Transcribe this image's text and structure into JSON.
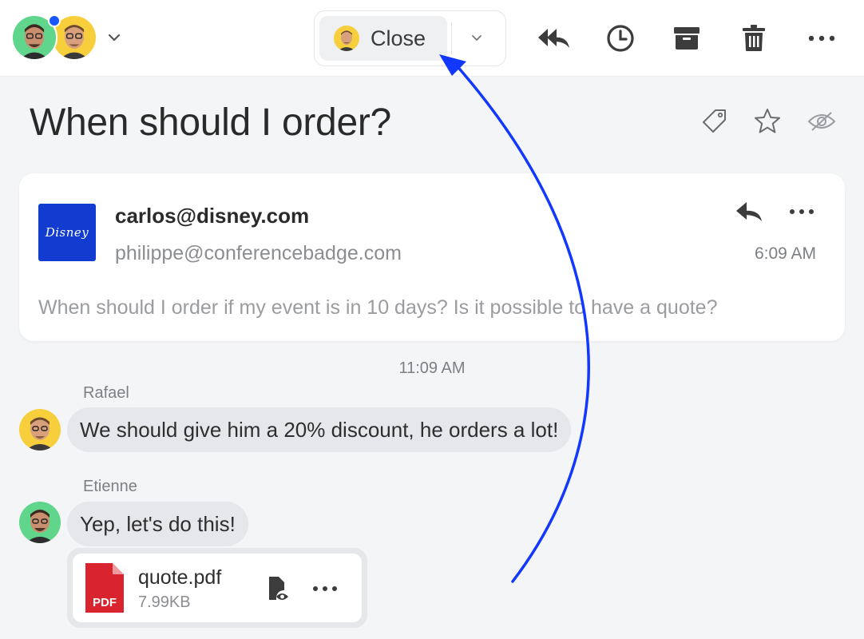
{
  "toolbar": {
    "close_label": "Close",
    "icons": [
      "reply-all-icon",
      "clock-icon",
      "archive-icon",
      "trash-icon",
      "more-icon"
    ]
  },
  "conversation": {
    "subject": "When should I order?",
    "subject_icons": [
      "tag-icon",
      "star-icon",
      "eye-slash-icon"
    ]
  },
  "email": {
    "brand": "Disney",
    "from": "carlos@disney.com",
    "to": "philippe@conferencebadge.com",
    "time": "6:09 AM",
    "preview": "When should I order if my event is in 10 days? Is it possible to have a quote?"
  },
  "chat": {
    "divider_time": "11:09 AM",
    "messages": [
      {
        "sender": "Rafael",
        "text": "We should give him a 20% discount, he orders a lot!"
      },
      {
        "sender": "Etienne",
        "text": "Yep, let's do this!"
      }
    ],
    "attachment": {
      "type_label": "PDF",
      "name": "quote.pdf",
      "size": "7.99KB"
    }
  },
  "colors": {
    "accent_blue": "#1a56ff",
    "brand_blue": "#113ccf",
    "pdf_red": "#d9232e",
    "bubble_bg": "#e6e7ea",
    "page_bg": "#f4f5f7"
  }
}
